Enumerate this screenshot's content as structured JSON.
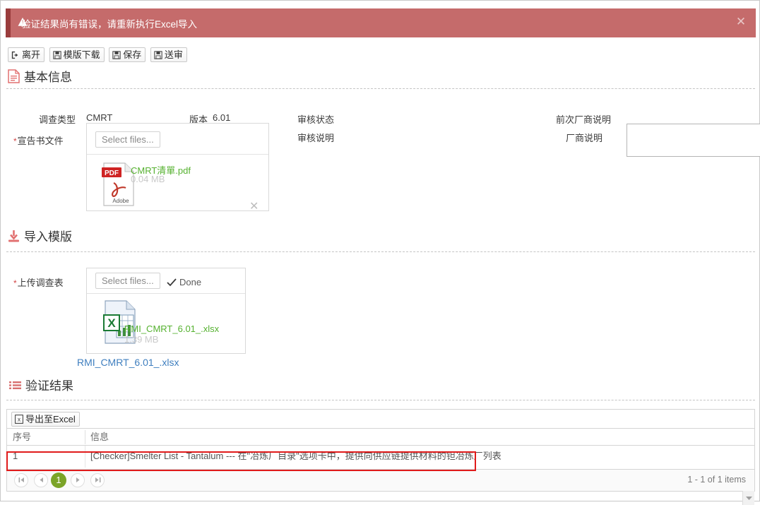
{
  "alert": {
    "message": "验证结果尚有错误，请重新执行Excel导入",
    "warning_icon": "warning-triangle-icon",
    "close_label": "✕",
    "bg_color": "#c56b6b",
    "stripe_color": "#9a3c3c"
  },
  "toolbar": {
    "buttons": [
      {
        "label": "离开",
        "icon": "exit-icon"
      },
      {
        "label": "模版下载",
        "icon": "save-disk-icon"
      },
      {
        "label": "保存",
        "icon": "save-disk-icon"
      },
      {
        "label": "送审",
        "icon": "save-disk-icon"
      }
    ]
  },
  "sections": {
    "basic_info": {
      "title": "基本信息",
      "icon": "document-icon",
      "fields": {
        "survey_type_label": "调查类型",
        "survey_type_value": "CMRT",
        "version_label": "版本",
        "version_value": "6.01",
        "declaration_file_label": "宣告书文件",
        "review_status_label": "审核状态",
        "review_status_value": "",
        "review_note_label": "审核说明",
        "review_note_value": "",
        "prev_vendor_note_label": "前次厂商说明",
        "prev_vendor_note_value": "",
        "vendor_note_label": "厂商说明",
        "vendor_note_value": "",
        "vendor_note_placeholder": ""
      },
      "upload": {
        "select_files_label": "Select files...",
        "file_name": "CMRT清單.pdf",
        "file_size": "0.04 MB",
        "file_icon": "pdf-file-icon",
        "remove_label": "✕"
      }
    },
    "import_template": {
      "title": "导入模版",
      "icon": "download-icon",
      "upload_label": "上传调查表",
      "upload": {
        "select_files_label": "Select files...",
        "status_label": "Done",
        "status_icon": "check-icon",
        "file_name": "RMI_CMRT_6.01_.xlsx",
        "file_size": "1.39 MB",
        "file_icon": "excel-file-icon"
      },
      "download_link": "RMI_CMRT_6.01_.xlsx"
    },
    "validation": {
      "title": "验证结果",
      "icon": "list-icon",
      "export_button": {
        "label": "导出至Excel",
        "icon": "excel-export-icon"
      },
      "columns": [
        "序号",
        "信息"
      ],
      "rows": [
        {
          "seq": "1",
          "message": "[Checker]Smelter List - Tantalum --- 在\"冶炼厂目录\"选项卡中，提供向供应链提供材料的钽冶炼厂列表"
        }
      ],
      "highlight_color": "#e01b1b",
      "pager": {
        "first_icon": "first-page-icon",
        "prev_icon": "prev-page-icon",
        "current_page": "1",
        "next_icon": "next-page-icon",
        "last_icon": "last-page-icon",
        "info": "1 - 1 of 1 items",
        "active_color": "#7ba428"
      }
    }
  }
}
